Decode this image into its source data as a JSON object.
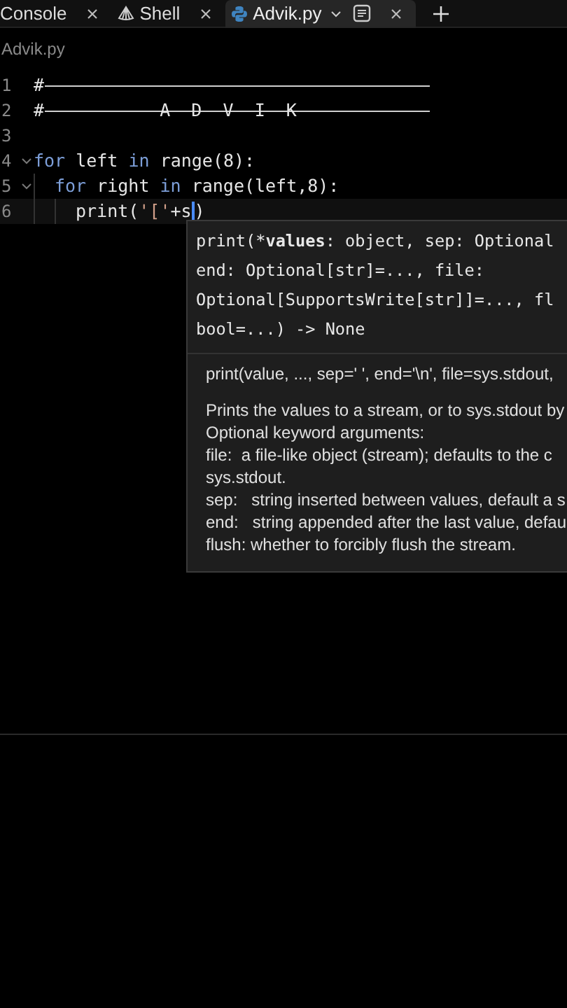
{
  "tabs": [
    {
      "label": "Console",
      "selected": false
    },
    {
      "label": "Shell",
      "selected": false
    },
    {
      "label": "Advik.py",
      "selected": true
    }
  ],
  "breadcrumb": "Advik.py",
  "code_lines": [
    {
      "number": "1",
      "foldable": false,
      "current": false,
      "tokens": [
        {
          "kind": "comment",
          "text": "#"
        },
        {
          "kind": "rule"
        }
      ]
    },
    {
      "number": "2",
      "foldable": false,
      "current": false,
      "tokens": [
        {
          "kind": "comment",
          "text": "#"
        },
        {
          "kind": "rule",
          "text": "A  D  V  I  K"
        }
      ]
    },
    {
      "number": "3",
      "foldable": false,
      "current": false
    },
    {
      "number": "4",
      "foldable": true,
      "current": false,
      "tokens": [
        {
          "kind": "keyword",
          "text": "for"
        },
        {
          "kind": "plain",
          "text": " left "
        },
        {
          "kind": "keyword",
          "text": "in"
        },
        {
          "kind": "plain",
          "text": " range(8):"
        }
      ]
    },
    {
      "number": "5",
      "foldable": true,
      "current": false,
      "tokens": [
        {
          "kind": "indent"
        },
        {
          "kind": "keyword",
          "text": "for"
        },
        {
          "kind": "plain",
          "text": " right "
        },
        {
          "kind": "keyword",
          "text": "in"
        },
        {
          "kind": "plain",
          "text": " range(left,8):"
        }
      ]
    },
    {
      "number": "6",
      "foldable": false,
      "current": true,
      "tokens": [
        {
          "kind": "indent"
        },
        {
          "kind": "indent"
        },
        {
          "kind": "plain",
          "text": "print("
        },
        {
          "kind": "string",
          "text": "'['"
        },
        {
          "kind": "plain",
          "text": "+s"
        },
        {
          "kind": "cursor"
        },
        {
          "kind": "plain",
          "text": ")"
        }
      ]
    }
  ],
  "tooltip": {
    "signature": [
      [
        {
          "text": "print(*",
          "bold": false
        },
        {
          "text": "values",
          "bold": true
        },
        {
          "text": ": object, sep: Optional",
          "bold": false
        }
      ],
      [
        {
          "text": "end: Optional[str]=..., file:",
          "bold": false
        }
      ],
      [
        {
          "text": "Optional[SupportsWrite[str]]=..., fl",
          "bold": false
        }
      ],
      [
        {
          "text": "bool=...) -> None",
          "bold": false
        }
      ]
    ],
    "call": "print(value, ..., sep=' ', end='\\n', file=sys.stdout,",
    "doc": [
      "Prints the values to a stream, or to sys.stdout by",
      "Optional keyword arguments:",
      "file:  a file-like object (stream); defaults to the c",
      "sys.stdout.",
      "sep:   string inserted between values, default a s",
      "end:   string appended after the last value, defau",
      "flush: whether to forcibly flush the stream."
    ]
  }
}
